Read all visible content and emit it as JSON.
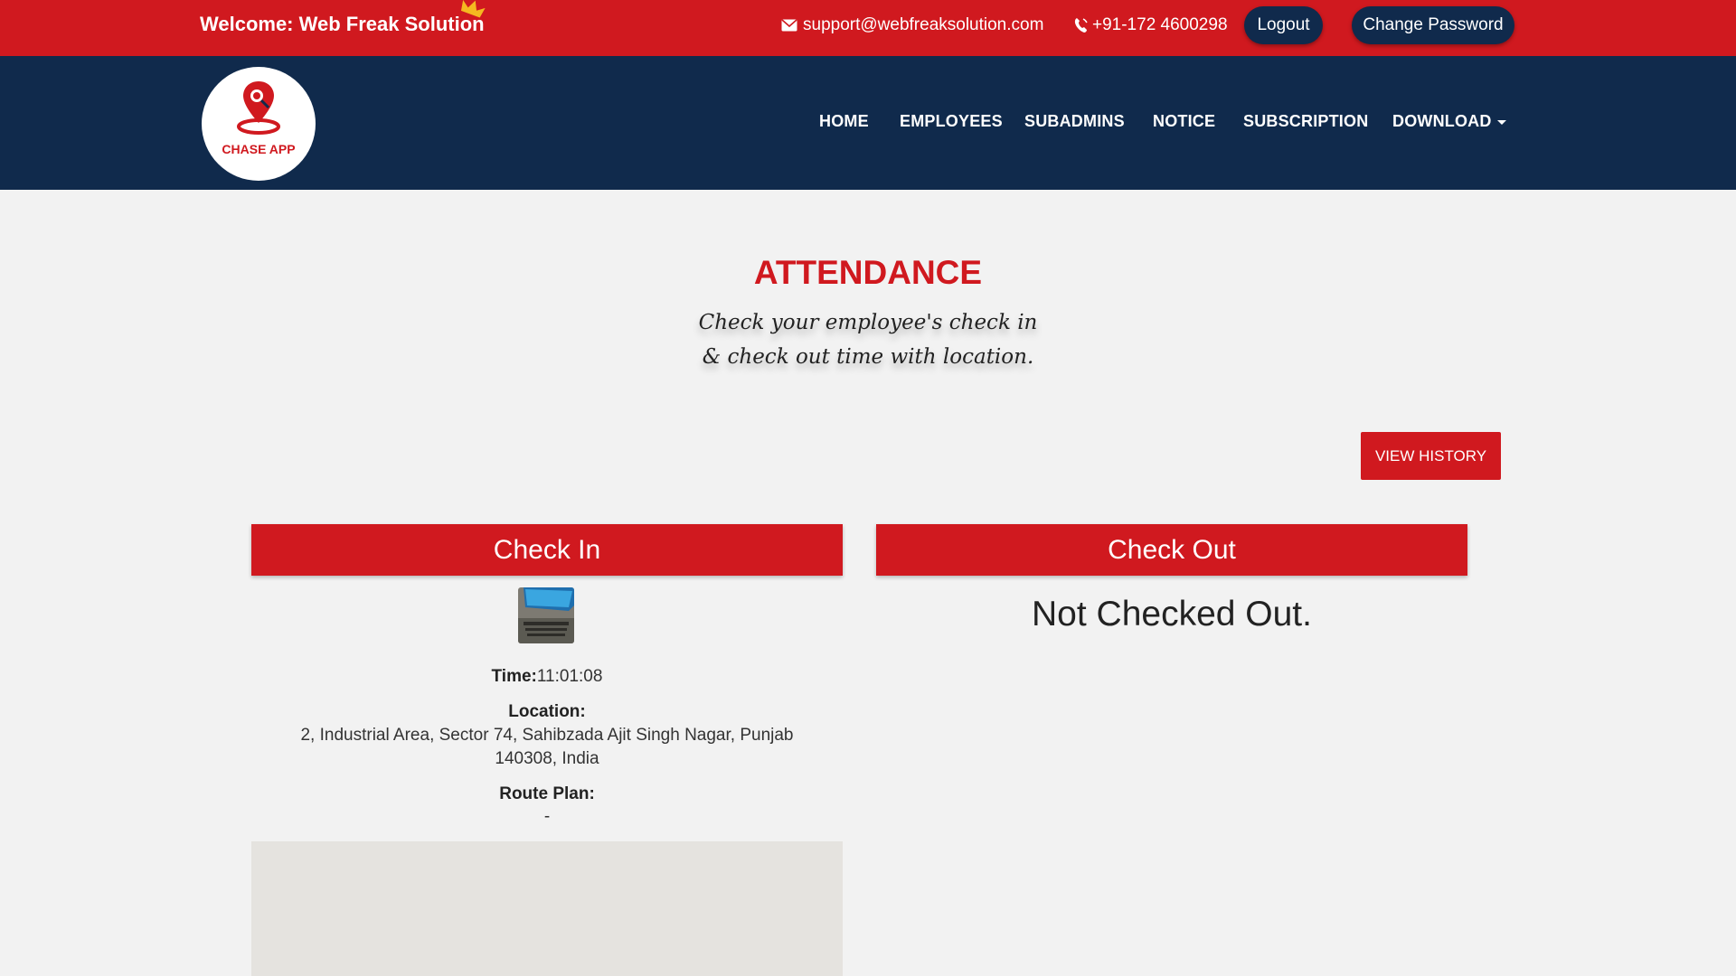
{
  "header": {
    "welcome": "Welcome: Web Freak Solution",
    "email": "support@webfreaksolution.com",
    "phone": "+91-172 4600298",
    "logout_label": "Logout",
    "change_password_label": "Change Password"
  },
  "logo": {
    "text": "CHASE APP"
  },
  "nav": {
    "items": [
      {
        "label": "HOME"
      },
      {
        "label": "EMPLOYEES"
      },
      {
        "label": "SUBADMINS"
      },
      {
        "label": "NOTICE"
      },
      {
        "label": "SUBSCRIPTION"
      },
      {
        "label": "DOWNLOAD"
      }
    ]
  },
  "page": {
    "title": "ATTENDANCE",
    "subtitle_line1": "Check your employee's check in",
    "subtitle_line2": "& check out time with location.",
    "view_history_label": "VIEW HISTORY"
  },
  "checkin": {
    "header": "Check In",
    "time_label": "Time:",
    "time_value": "11:01:08",
    "location_label": "Location:",
    "location_line1": "2, Industrial Area, Sector 74, Sahibzada Ajit Singh Nagar, Punjab",
    "location_line2": "140308, India",
    "route_label": "Route Plan:",
    "route_value": "-"
  },
  "checkout": {
    "header": "Check Out",
    "status": "Not Checked Out."
  },
  "colors": {
    "brand_red": "#d0191f",
    "navy": "#102a4c",
    "background": "#f2f2f2"
  }
}
